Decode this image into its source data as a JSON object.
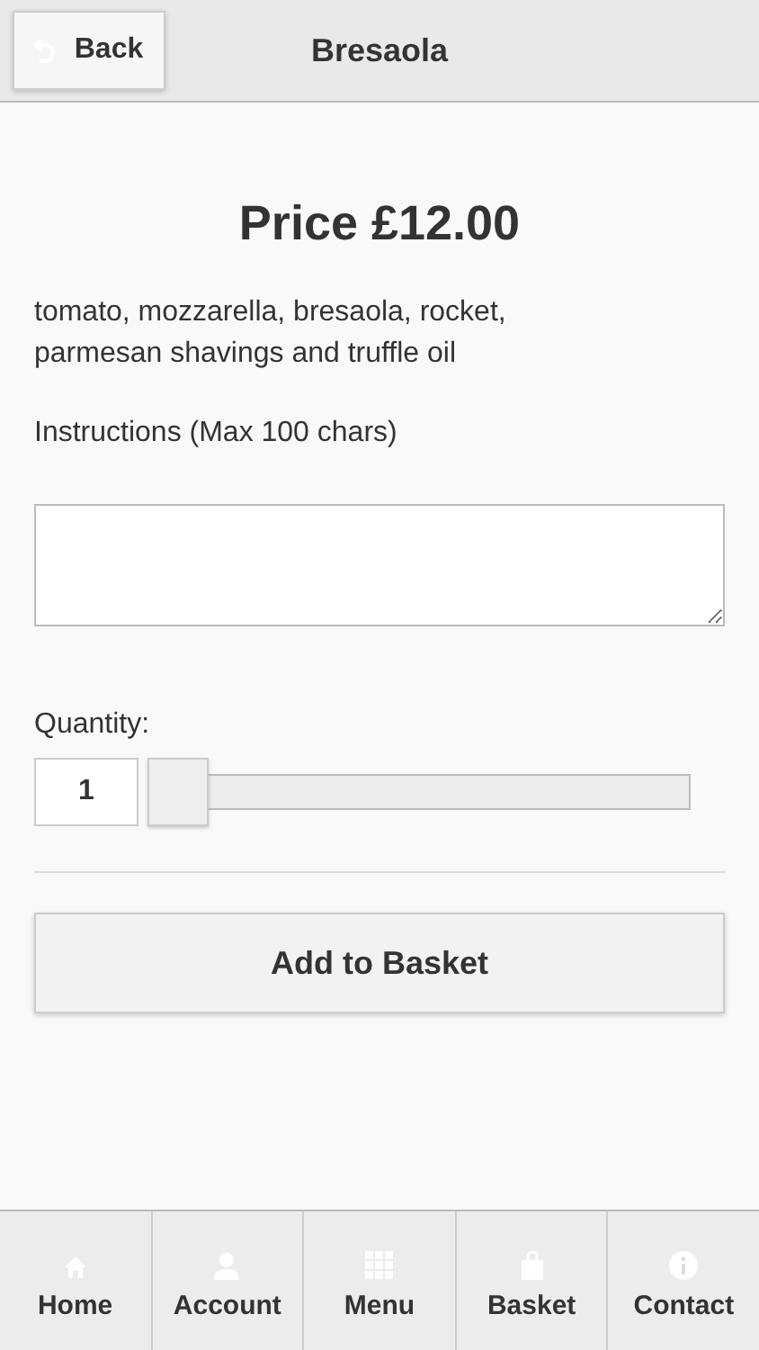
{
  "header": {
    "back_label": "Back",
    "title": "Bresaola"
  },
  "price": "Price £12.00",
  "description": "tomato, mozzarella, bresaola, rocket, parmesan shavings and truffle oil",
  "instructions_label": "Instructions (Max 100 chars)",
  "quantity": {
    "label": "Quantity:",
    "value": "1",
    "level": 0
  },
  "add_button": "Add to Basket",
  "nav": [
    {
      "kind": "home",
      "label": "Home"
    },
    {
      "kind": "account",
      "label": "Account"
    },
    {
      "kind": "menu",
      "label": "Menu"
    },
    {
      "kind": "basket",
      "label": "Basket"
    },
    {
      "kind": "contact",
      "label": "Contact"
    }
  ]
}
